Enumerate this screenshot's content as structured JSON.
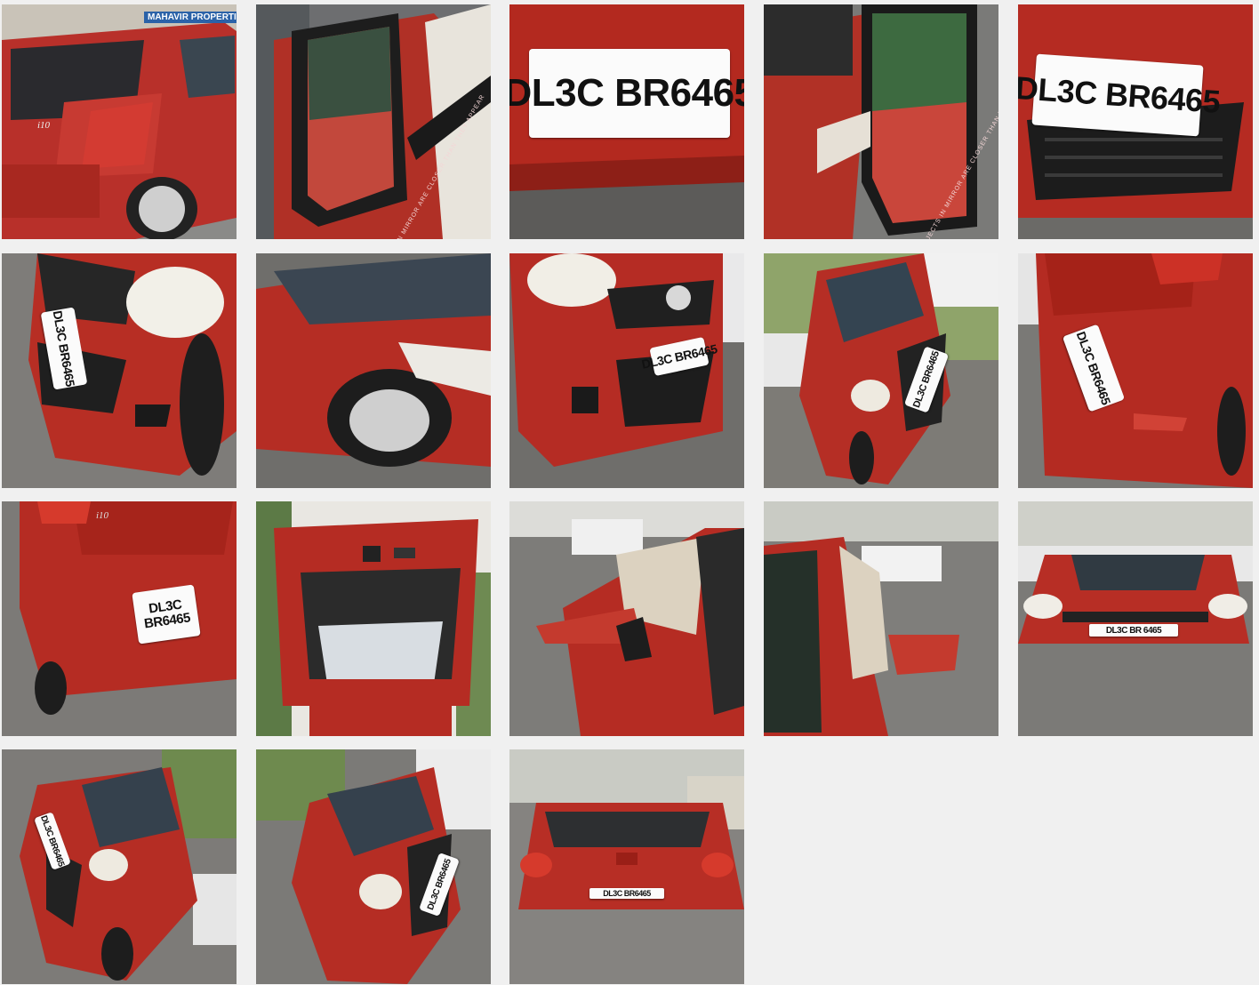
{
  "gallery": {
    "plate": "DL3C BR6465",
    "plate_spaced": "DL3C BR 6465",
    "model_badge": "i10",
    "shop_sign": "MAHAVIR PROPERTIES",
    "mirror_warning_left": "OBJECTS IN MIRROR ARE CLOSER THAN THEY APPEAR",
    "mirror_warning_right": "OBJECTS IN MIRROR ARE CLOSER THAN THEY APPEAR",
    "tiles": [
      {
        "view": "rear-left quarter of red hatchback"
      },
      {
        "view": "left side mirror close-up"
      },
      {
        "view": "rear number plate close-up"
      },
      {
        "view": "right side mirror close-up"
      },
      {
        "view": "front number plate close-up"
      },
      {
        "view": "front-left bumper and headlamp"
      },
      {
        "view": "left side with front wheel"
      },
      {
        "view": "front-right bumper and grille"
      },
      {
        "view": "front-left top view"
      },
      {
        "view": "rear bumper with plate"
      },
      {
        "view": "rear bumper lower view"
      },
      {
        "view": "open tailgate"
      },
      {
        "view": "front-left door and mirror"
      },
      {
        "view": "right side door and mirror"
      },
      {
        "view": "full front view"
      },
      {
        "view": "front-left three-quarter view"
      },
      {
        "view": "front-right three-quarter view"
      },
      {
        "view": "full rear view"
      }
    ]
  },
  "colors": {
    "car_red": "#b8302a",
    "background": "#f0f0f0",
    "road_gray": "#7d7b78"
  }
}
